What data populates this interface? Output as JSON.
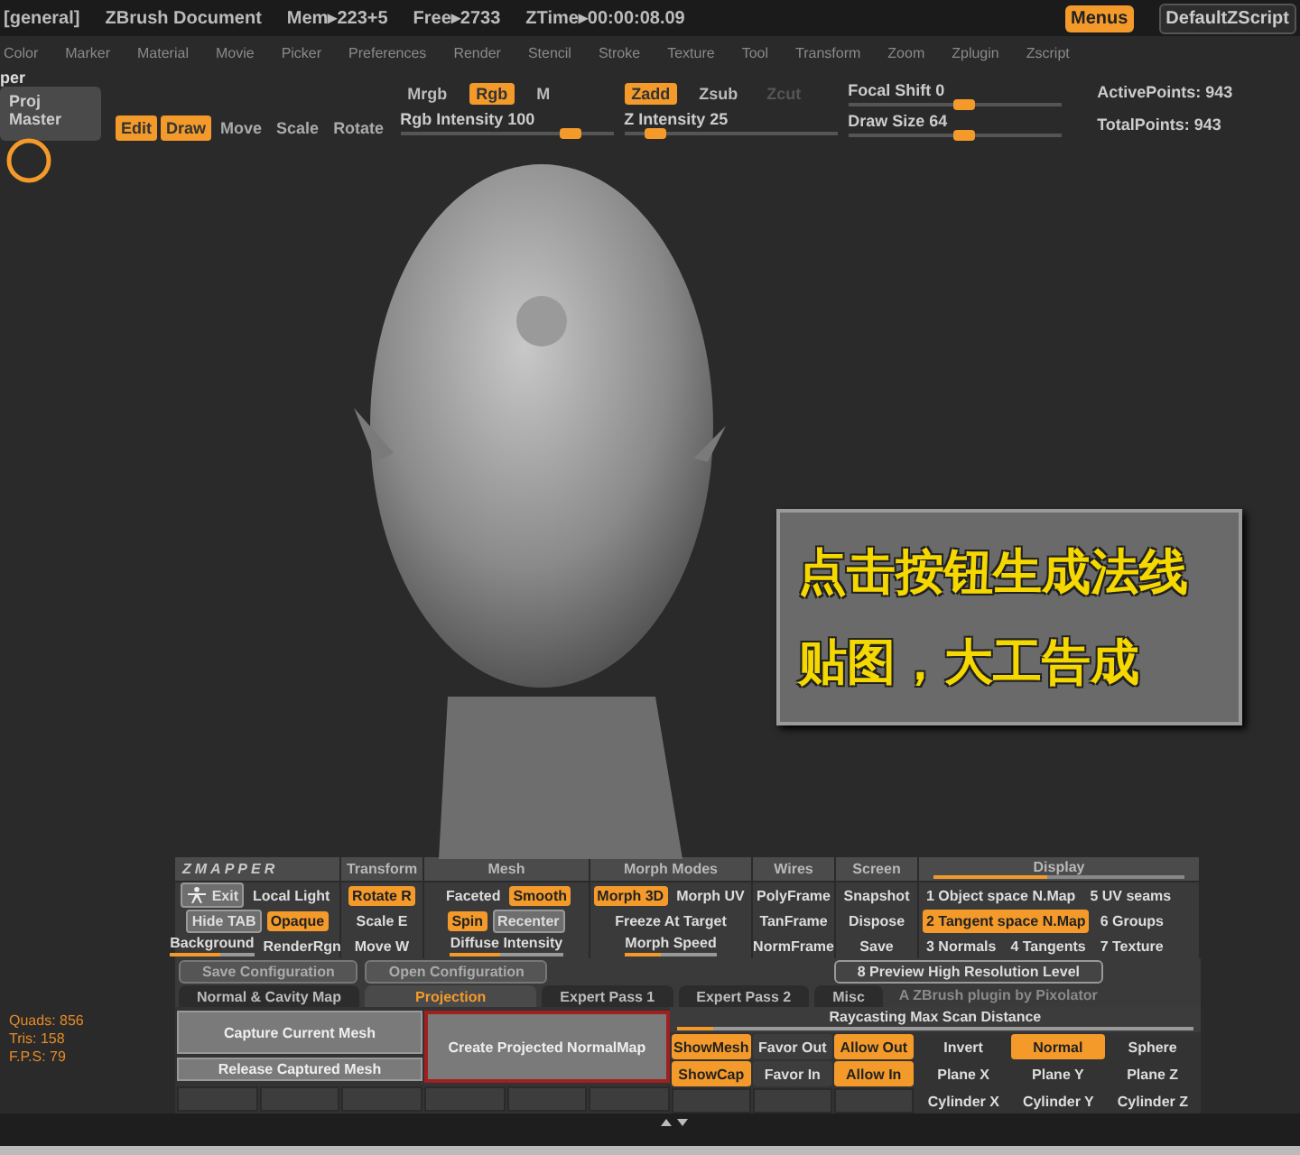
{
  "title_bar": {
    "items": [
      "[general]",
      "ZBrush Document",
      "Mem▸223+5",
      "Free▸2733",
      "ZTime▸00:00:08.09"
    ],
    "menus_button": {
      "label": "Menus",
      "on": true
    },
    "script": "DefaultZScript"
  },
  "menu": [
    "Color",
    "Marker",
    "Material",
    "Movie",
    "Picker",
    "Preferences",
    "Render",
    "Stencil",
    "Stroke",
    "Texture",
    "Tool",
    "Transform",
    "Zoom",
    "Zplugin",
    "Zscript"
  ],
  "toolbar": {
    "doc_label": "per",
    "palette_button": [
      "Proj",
      "Master"
    ],
    "modes": [
      {
        "label": "Edit",
        "on": true
      },
      {
        "label": "Draw",
        "on": true
      },
      {
        "label": "Move",
        "on": false
      },
      {
        "label": "Scale",
        "on": false
      },
      {
        "label": "Rotate",
        "on": false
      }
    ],
    "color_modes": [
      {
        "label": "Mrgb",
        "on": false,
        "disabled": false
      },
      {
        "label": "Rgb",
        "on": true,
        "disabled": false
      },
      {
        "label": "M",
        "on": false,
        "disabled": false
      }
    ],
    "rgb_intensity": {
      "label": "Rgb Intensity 100",
      "level": 0.8
    },
    "z_modes": [
      {
        "label": "Zadd",
        "on": true,
        "disabled": false
      },
      {
        "label": "Zsub",
        "on": false,
        "disabled": false
      },
      {
        "label": "Zcut",
        "on": false,
        "disabled": true
      }
    ],
    "z_intensity": {
      "label": "Z Intensity 25",
      "level": 0.15
    },
    "focal_shift": {
      "label": "Focal Shift 0",
      "level": 0.55
    },
    "draw_size": {
      "label": "Draw Size 64",
      "level": 0.55
    },
    "stats": [
      "ActivePoints: 943",
      "TotalPoints: 943"
    ]
  },
  "canvas": {
    "caption": [
      "点击按钮生成法线",
      "贴图，大工告成"
    ],
    "stats": [
      "Quads: 856",
      "Tris: 158",
      "F.P.S: 79"
    ]
  },
  "zmapper": {
    "sections": [
      {
        "title": "ZMAPPER",
        "rows": [
          [
            {
              "kind": "box_icon",
              "label": "Exit",
              "on": false
            },
            {
              "kind": "plain",
              "label": "Local Light",
              "on": false
            }
          ],
          [
            {
              "kind": "box",
              "label": "Hide TAB",
              "on": false
            },
            {
              "kind": "plain",
              "label": "Opaque",
              "on": true
            }
          ],
          [
            {
              "kind": "slider",
              "label": "Background",
              "level": 0.6
            },
            {
              "kind": "plain",
              "label": "RenderRgn",
              "on": false
            }
          ]
        ]
      },
      {
        "title": "Transform",
        "rows": [
          [
            {
              "kind": "plain",
              "label": "Rotate R",
              "on": true
            }
          ],
          [
            {
              "kind": "plain",
              "label": "Scale E",
              "on": false
            }
          ],
          [
            {
              "kind": "plain",
              "label": "Move W",
              "on": false
            }
          ]
        ]
      },
      {
        "title": "Mesh",
        "rows": [
          [
            {
              "kind": "plain",
              "label": "Faceted",
              "on": false
            },
            {
              "kind": "plain",
              "label": "Smooth",
              "on": true
            }
          ],
          [
            {
              "kind": "plain",
              "label": "Spin",
              "on": true
            },
            {
              "kind": "box",
              "label": "Recenter",
              "on": false
            }
          ],
          [
            {
              "kind": "slider",
              "label": "Diffuse Intensity",
              "level": 0.45
            }
          ]
        ]
      },
      {
        "title": "Morph Modes",
        "rows": [
          [
            {
              "kind": "plain",
              "label": "Morph 3D",
              "on": true
            },
            {
              "kind": "plain",
              "label": "Morph UV",
              "on": false
            }
          ],
          [
            {
              "kind": "plain",
              "label": "Freeze At Target",
              "on": false
            }
          ],
          [
            {
              "kind": "slider",
              "label": "Morph Speed",
              "level": 0.4
            }
          ]
        ]
      },
      {
        "title": "Wires",
        "rows": [
          [
            {
              "kind": "plain",
              "label": "PolyFrame",
              "on": false
            }
          ],
          [
            {
              "kind": "plain",
              "label": "TanFrame",
              "on": false
            }
          ],
          [
            {
              "kind": "plain",
              "label": "NormFrame",
              "on": false
            }
          ]
        ]
      },
      {
        "title": "Screen",
        "rows": [
          [
            {
              "kind": "plain",
              "label": "Snapshot",
              "on": false
            }
          ],
          [
            {
              "kind": "plain",
              "label": "Dispose",
              "on": false
            }
          ],
          [
            {
              "kind": "plain",
              "label": "Save",
              "on": false
            }
          ]
        ]
      },
      {
        "title": "Display",
        "level": 0.45,
        "items": [
          {
            "label": "1 Object space N.Map",
            "on": false
          },
          {
            "label": "5 UV seams",
            "on": false
          },
          {
            "label": "2 Tangent space N.Map",
            "on": true
          },
          {
            "label": "6 Groups",
            "on": false
          },
          {
            "label": "3 Normals",
            "on": false
          },
          {
            "label": "4 Tangents",
            "on": false
          },
          {
            "label": "7 Texture",
            "on": false
          }
        ]
      }
    ],
    "config": [
      "Save Configuration",
      "Open Configuration"
    ],
    "preview": "8 Preview High Resolution Level",
    "tabs": [
      {
        "label": "Normal & Cavity Map",
        "selected": false
      },
      {
        "label": "Projection",
        "selected": true
      },
      {
        "label": "Expert Pass 1",
        "selected": false
      },
      {
        "label": "Expert Pass 2",
        "selected": false
      },
      {
        "label": "Misc",
        "selected": false
      }
    ],
    "credit": "A ZBrush plugin by Pixolator",
    "capture": [
      "Capture Current Mesh",
      "Release Captured Mesh"
    ],
    "create": "Create Projected NormalMap",
    "scan": {
      "label": "Raycasting Max Scan Distance",
      "level": 0.07
    },
    "options": [
      [
        {
          "label": "ShowMesh",
          "on": true
        },
        {
          "label": "Favor Out",
          "on": false
        },
        {
          "label": "Allow Out",
          "on": true
        }
      ],
      [
        {
          "label": "ShowCap",
          "on": true
        },
        {
          "label": "Favor In",
          "on": false
        },
        {
          "label": "Allow In",
          "on": true
        }
      ]
    ],
    "shapes": [
      [
        {
          "label": "Invert",
          "on": false
        },
        {
          "label": "Normal",
          "on": true
        },
        {
          "label": "Sphere",
          "on": false
        }
      ],
      [
        {
          "label": "Plane X",
          "on": false
        },
        {
          "label": "Plane Y",
          "on": false
        },
        {
          "label": "Plane Z",
          "on": false
        }
      ],
      [
        {
          "label": "Cylinder X",
          "on": false
        },
        {
          "label": "Cylinder Y",
          "on": false
        },
        {
          "label": "Cylinder Z",
          "on": false
        }
      ]
    ]
  }
}
